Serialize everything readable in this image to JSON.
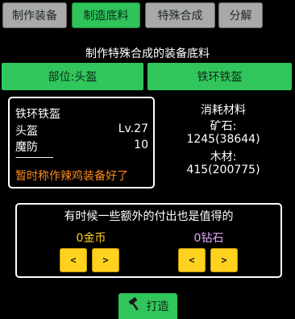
{
  "tabs": [
    {
      "label": "制作装备",
      "active": false
    },
    {
      "label": "制造底料",
      "active": true
    },
    {
      "label": "特殊合成",
      "active": false
    },
    {
      "label": "分解",
      "active": false
    }
  ],
  "title": "制作特殊合成的装备底料",
  "selectors": {
    "part": "部位:头盔",
    "material": "铁环铁盔"
  },
  "item_card": {
    "name": "铁环铁盔",
    "slot": "头盔",
    "level": "Lv.27",
    "stat_name": "魔防",
    "stat_value": "10",
    "divider": "--------------",
    "note": "暂时称作辣鸡装备好了"
  },
  "materials": {
    "header": "消耗材料",
    "ore_label": "矿石:",
    "ore_value": "1245(38644)",
    "wood_label": "木材:",
    "wood_value": "415(200775)"
  },
  "extra": {
    "title": "有时候一些额外的付出也是值得的",
    "gold": "0金币",
    "diamond": "0钻石",
    "dec": "<",
    "inc": ">"
  },
  "forge_label": "打造",
  "colors": {
    "tab_active": "#2fc35a",
    "tab_inactive": "#a9a9a9",
    "green": "#31c65c",
    "yellow_button": "#ffd21f",
    "gold_text": "#ffd21f",
    "diamond_text": "#e7a7ff",
    "note_text": "#ff8a1a"
  }
}
